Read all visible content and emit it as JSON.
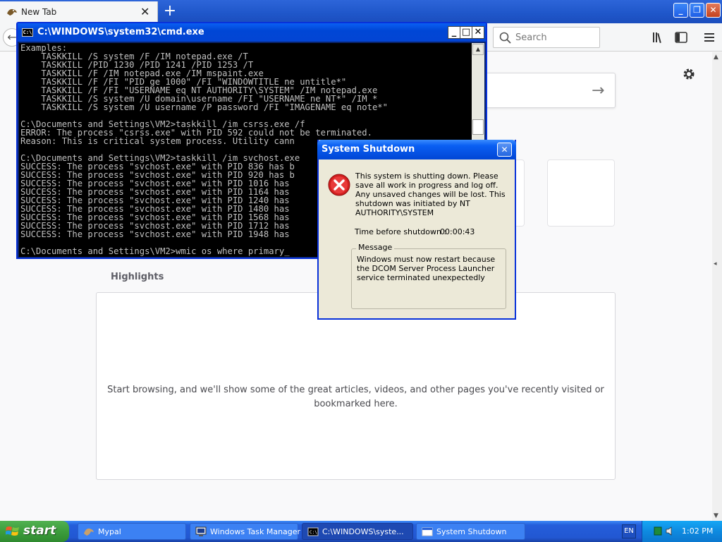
{
  "browser": {
    "tab_title": "New Tab",
    "tab_close": "✕",
    "new_tab": "+",
    "search_placeholder": "Search",
    "highlights_title": "Highlights",
    "empty_message": "Start browsing, and we'll show some of the great articles, videos, and other pages you've recently visited or bookmarked here."
  },
  "cmd": {
    "title": "C:\\WINDOWS\\system32\\cmd.exe",
    "lines": [
      "Examples:",
      "    TASKKILL /S system /F /IM notepad.exe /T",
      "    TASKKILL /PID 1230 /PID 1241 /PID 1253 /T",
      "    TASKKILL /F /IM notepad.exe /IM mspaint.exe",
      "    TASKKILL /F /FI \"PID ge 1000\" /FI \"WINDOWTITLE ne untitle*\"",
      "    TASKKILL /F /FI \"USERNAME eq NT AUTHORITY\\SYSTEM\" /IM notepad.exe",
      "    TASKKILL /S system /U domain\\username /FI \"USERNAME ne NT*\" /IM *",
      "    TASKKILL /S system /U username /P password /FI \"IMAGENAME eq note*\"",
      "",
      "C:\\Documents and Settings\\VM2>taskkill /im csrss.exe /f",
      "ERROR: The process \"csrss.exe\" with PID 592 could not be terminated.",
      "Reason: This is critical system process. Utility cann",
      "",
      "C:\\Documents and Settings\\VM2>taskkill /im svchost.exe",
      "SUCCESS: The process \"svchost.exe\" with PID 836 has b",
      "SUCCESS: The process \"svchost.exe\" with PID 920 has b",
      "SUCCESS: The process \"svchost.exe\" with PID 1016 has",
      "SUCCESS: The process \"svchost.exe\" with PID 1164 has",
      "SUCCESS: The process \"svchost.exe\" with PID 1240 has",
      "SUCCESS: The process \"svchost.exe\" with PID 1480 has",
      "SUCCESS: The process \"svchost.exe\" with PID 1568 has",
      "SUCCESS: The process \"svchost.exe\" with PID 1712 has",
      "SUCCESS: The process \"svchost.exe\" with PID 1948 has",
      "",
      "C:\\Documents and Settings\\VM2>wmic os where primary_"
    ]
  },
  "dialog": {
    "title": "System Shutdown",
    "close": "✕",
    "warning": "This system is shutting down. Please save all work in progress and log off. Any unsaved changes will be lost. This shutdown was initiated by NT AUTHORITY\\SYSTEM",
    "time_label": "Time before shutdown :",
    "time_value": "00:00:43",
    "message_label": "Message",
    "message_text": "Windows must now restart because the DCOM Server Process Launcher service terminated unexpectedly"
  },
  "taskbar": {
    "start": "start",
    "tasks": [
      {
        "label": "Mypal"
      },
      {
        "label": "Windows Task Manager"
      },
      {
        "label": "C:\\WINDOWS\\syste..."
      },
      {
        "label": "System Shutdown"
      }
    ],
    "language": "EN",
    "clock": "1:02 PM"
  }
}
